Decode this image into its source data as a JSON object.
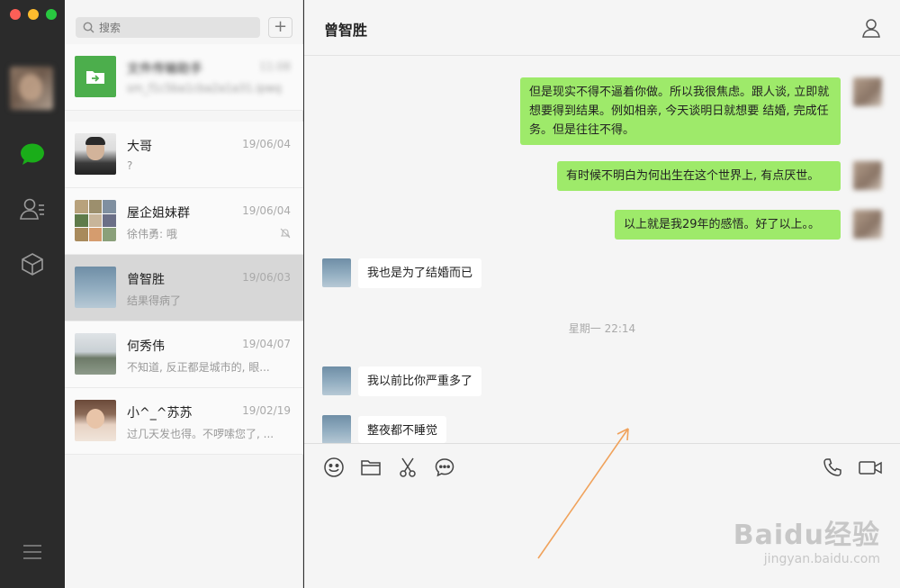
{
  "window": {
    "title": "曾智胜"
  },
  "search": {
    "placeholder": "搜索"
  },
  "list": {
    "add_label": "+",
    "items": [
      {
        "name": "文件传输助手",
        "date": "11:08",
        "preview": "sm_f1c5ba1cba2a1a31.ipwq",
        "blurred": true
      },
      {
        "name": "大哥",
        "date": "19/06/04",
        "preview": "?"
      },
      {
        "name": "屋企姐妹群",
        "date": "19/06/04",
        "preview": "徐伟勇: 哦"
      },
      {
        "name": "曾智胜",
        "date": "19/06/03",
        "preview": "结果得病了"
      },
      {
        "name": "何秀伟",
        "date": "19/04/07",
        "preview": "不知道, 反正都是城市的, 眼..."
      },
      {
        "name": "小^_^苏苏",
        "date": "19/02/19",
        "preview": "过几天发也得。不啰嗦您了, ..."
      }
    ]
  },
  "chat": {
    "title": "曾智胜",
    "messages": [
      {
        "from": "me",
        "text": "但是现实不得不逼着你做。所以我很焦虑。跟人谈, 立即就想要得到结果。例如相亲, 今天谈明日就想要 结婚, 完成任务。但是往往不得。"
      },
      {
        "from": "me",
        "text": "有时候不明白为何出生在这个世界上, 有点厌世。"
      },
      {
        "from": "me",
        "text": "以上就是我29年的感悟。好了以上。。"
      },
      {
        "from": "other",
        "text": "我也是为了结婚而已"
      },
      {
        "from": "other",
        "text": "我以前比你严重多了"
      },
      {
        "from": "other",
        "text": "整夜都不睡觉"
      }
    ],
    "timestamp": "星期一 22:14"
  },
  "watermark": {
    "brand": "Baidu经验",
    "url": "jingyan.baidu.com"
  },
  "colors": {
    "bubble_me": "#9eea6a",
    "rail": "#2b2b2b",
    "accent": "#1aad19"
  }
}
